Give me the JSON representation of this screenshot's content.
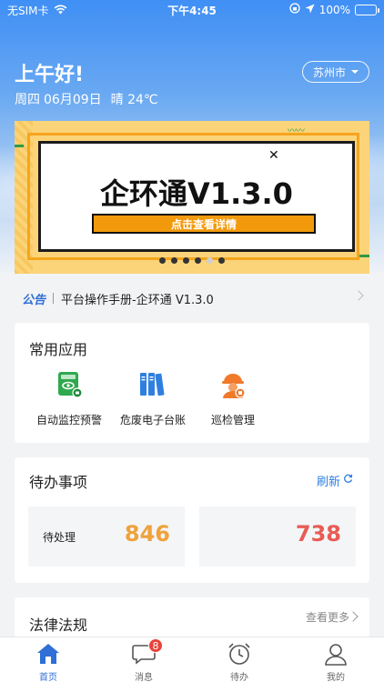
{
  "status_bar": {
    "carrier": "无SIM卡",
    "time": "下午4:45",
    "battery": "100%"
  },
  "header": {
    "greeting": "上午好!",
    "weekday": "周四",
    "date": "06月09日",
    "weather": "晴 24℃",
    "city": "苏州市"
  },
  "banner": {
    "headline": "企环通V1.3.0",
    "cta": "点击查看详情",
    "slide_count": 6,
    "active_slide": 5
  },
  "notice": {
    "tag": "公告",
    "text": "平台操作手册-企环通 V1.3.0"
  },
  "apps": {
    "title": "常用应用",
    "items": [
      {
        "label": "自动监控预警",
        "icon": "monitor-alert-icon",
        "color": "#2fa84f"
      },
      {
        "label": "危废电子台账",
        "icon": "ledger-books-icon",
        "color": "#2f7fe0"
      },
      {
        "label": "巡检管理",
        "icon": "inspector-helmet-icon",
        "color": "#f07a2a"
      }
    ]
  },
  "todo": {
    "title": "待办事项",
    "refresh_label": "刷新",
    "stats": [
      {
        "label": "待处理",
        "value": "846",
        "color": "#f0a23b"
      },
      {
        "label": "",
        "value": "738",
        "color": "#e85c55"
      }
    ]
  },
  "law": {
    "title": "法律法规",
    "more_label": "查看更多"
  },
  "tabbar": {
    "items": [
      {
        "label": "首页",
        "icon": "home-icon",
        "active": true
      },
      {
        "label": "消息",
        "icon": "message-icon",
        "badge": "8"
      },
      {
        "label": "待办",
        "icon": "alarm-clock-icon"
      },
      {
        "label": "我的",
        "icon": "user-icon"
      }
    ],
    "accent": "#2f6fd6"
  }
}
